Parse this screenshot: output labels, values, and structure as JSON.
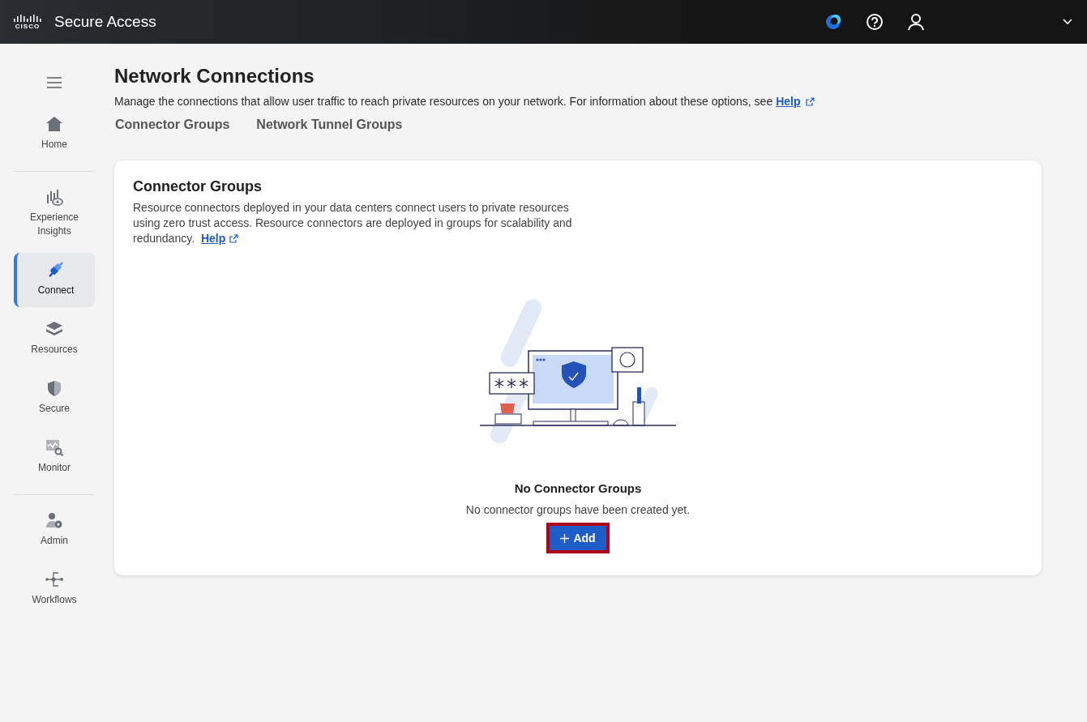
{
  "header": {
    "logo_text": "CISCO",
    "title": "Secure Access"
  },
  "sidebar": {
    "sections": [
      {
        "items": [
          {
            "label": "Home",
            "selected": false
          }
        ]
      },
      {
        "items": [
          {
            "label": "Experience Insights",
            "selected": false
          },
          {
            "label": "Connect",
            "selected": true
          },
          {
            "label": "Resources",
            "selected": false
          },
          {
            "label": "Secure",
            "selected": false
          },
          {
            "label": "Monitor",
            "selected": false
          }
        ]
      },
      {
        "items": [
          {
            "label": "Admin",
            "selected": false
          },
          {
            "label": "Workflows",
            "selected": false
          }
        ]
      }
    ]
  },
  "page": {
    "title": "Network Connections",
    "description": "Manage the connections that allow user traffic to reach private resources on your network. For information about these options, see",
    "help_link": "Help",
    "tabs": [
      {
        "label": "Connector Groups",
        "selected": false
      },
      {
        "label": "Network Tunnel Groups",
        "selected": false
      }
    ]
  },
  "card": {
    "title": "Connector Groups",
    "description": "Resource connectors deployed in your data centers connect users to private resources using zero trust access. Resource connectors are deployed in groups for scalability and redundancy.",
    "help_link": "Help",
    "empty_title": "No Connector Groups",
    "empty_text": "No connector groups have been created yet.",
    "add_button": {
      "label": "Add",
      "highlighted": true
    }
  }
}
